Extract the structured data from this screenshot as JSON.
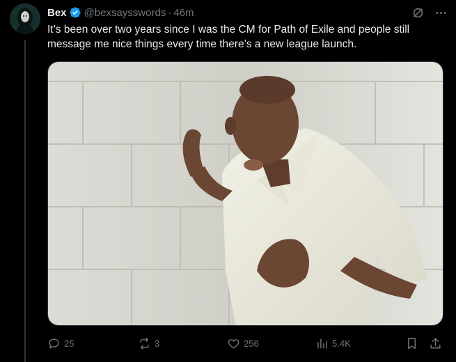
{
  "tweet": {
    "author_name": "Bex",
    "handle": "@bexsaysswords",
    "separator": "·",
    "time": "46m",
    "text": "It’s been over two years since I was the CM for Path of Exile and people still message me nice things every time there’s a new league launch.",
    "verified": true,
    "accent_color": "#1d9bf0"
  },
  "header_icons": [
    "grok-icon",
    "more-icon"
  ],
  "media": {
    "description_icon": "photo-man-at-brick-wall"
  },
  "actions": {
    "replies": "25",
    "retweets": "3",
    "likes": "256",
    "views": "5.4K"
  },
  "colors": {
    "background": "#000000",
    "text_primary": "#e7e9ea",
    "text_secondary": "#71767b",
    "verified": "#1d9bf0"
  }
}
